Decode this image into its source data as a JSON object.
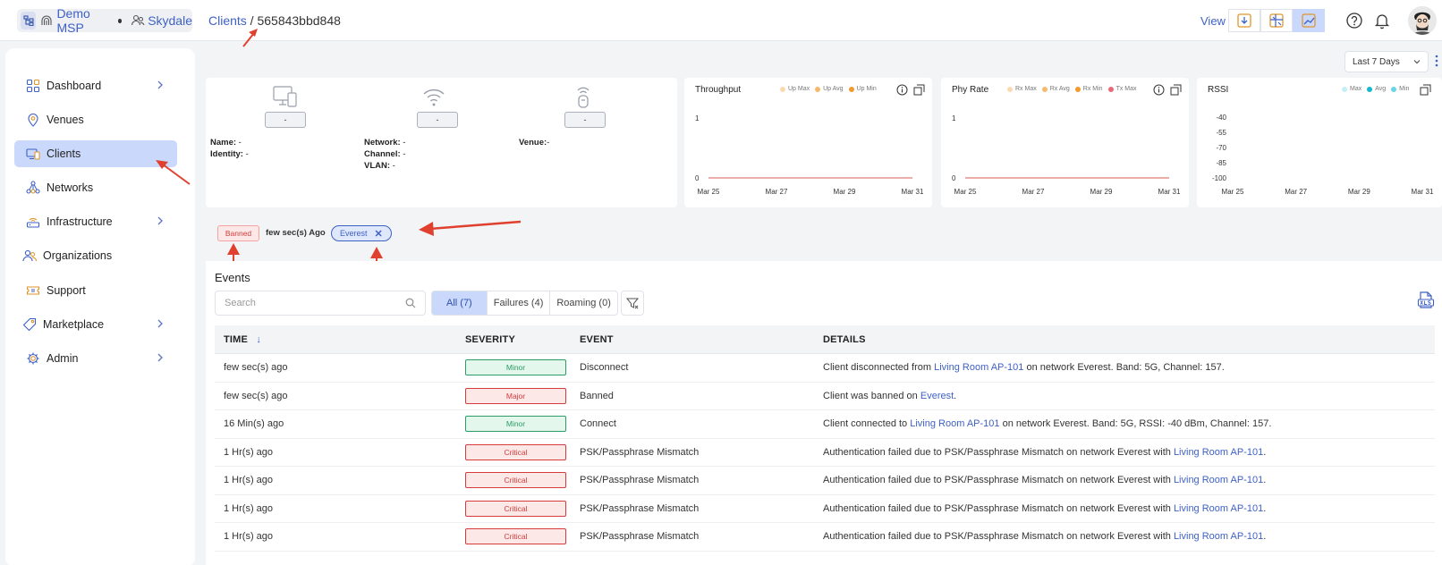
{
  "header": {
    "org_primary": "Demo MSP",
    "org_secondary": "Skydale",
    "breadcrumb_root": "Clients",
    "breadcrumb_sep": " / ",
    "breadcrumb_current": "565843bbd848",
    "view_label": "View",
    "accent_color": "#3f61c4"
  },
  "sidebar": {
    "items": [
      {
        "label": "Dashboard",
        "icon": "dashboard-grid-icon",
        "has_chevron": true,
        "active": false
      },
      {
        "label": "Venues",
        "icon": "location-pin-icon",
        "has_chevron": false,
        "active": false
      },
      {
        "label": "Clients",
        "icon": "devices-icon",
        "has_chevron": false,
        "active": true
      },
      {
        "label": "Networks",
        "icon": "network-nodes-icon",
        "has_chevron": false,
        "active": false
      },
      {
        "label": "Infrastructure",
        "icon": "router-icon",
        "has_chevron": true,
        "active": false
      },
      {
        "label": "Organizations",
        "icon": "users-icon",
        "has_chevron": false,
        "active": false
      },
      {
        "label": "Support",
        "icon": "ticket-icon",
        "has_chevron": false,
        "active": false
      },
      {
        "label": "Marketplace",
        "icon": "tag-icon",
        "has_chevron": true,
        "active": false
      },
      {
        "label": "Admin",
        "icon": "admin-gear-icon",
        "has_chevron": true,
        "active": false
      }
    ]
  },
  "range": {
    "value": "Last 7 Days"
  },
  "client_info": {
    "boxes": [
      "-",
      "-",
      "-"
    ],
    "name_label": "Name:",
    "name_value": " -",
    "identity_label": "Identity:",
    "identity_value": " -",
    "network_label": "Network:",
    "network_value": " -",
    "channel_label": "Channel:",
    "channel_value": " -",
    "vlan_label": "VLAN:",
    "vlan_value": " -",
    "venue_label": "Venue:",
    "venue_value": "-"
  },
  "charts": {
    "throughput": {
      "title": "Throughput",
      "legend": [
        "Up Max",
        "Up Avg",
        "Up Min"
      ],
      "legend_colors": [
        "#fbd9b0",
        "#f7b96a",
        "#f39a2c"
      ]
    },
    "phy_rate": {
      "title": "Phy Rate",
      "legend": [
        "Rx Max",
        "Rx Avg",
        "Rx Min",
        "Tx Max"
      ],
      "legend_colors": [
        "#fbd9b0",
        "#f7b96a",
        "#f39a2c",
        "#e86a78"
      ]
    },
    "rssi": {
      "title": "RSSI",
      "legend": [
        "Max",
        "Avg",
        "Min"
      ],
      "legend_colors": [
        "#c5eef7",
        "#16b7cf",
        "#67d6e6"
      ]
    }
  },
  "chart_data": [
    {
      "type": "line",
      "title": "Throughput",
      "x": [
        "Mar 25",
        "Mar 27",
        "Mar 29",
        "Mar 31"
      ],
      "yticks": [
        1,
        0
      ],
      "ylim": [
        0,
        1
      ],
      "series": [
        {
          "name": "Up Max",
          "values": [
            0,
            0,
            0,
            0
          ]
        },
        {
          "name": "Up Avg",
          "values": [
            0,
            0,
            0,
            0
          ]
        },
        {
          "name": "Up Min",
          "values": [
            0,
            0,
            0,
            0
          ]
        }
      ]
    },
    {
      "type": "line",
      "title": "Phy Rate",
      "x": [
        "Mar 25",
        "Mar 27",
        "Mar 29",
        "Mar 31"
      ],
      "yticks": [
        1,
        0
      ],
      "ylim": [
        0,
        1
      ],
      "series": [
        {
          "name": "Rx Max",
          "values": [
            0,
            0,
            0,
            0
          ]
        },
        {
          "name": "Rx Avg",
          "values": [
            0,
            0,
            0,
            0
          ]
        },
        {
          "name": "Rx Min",
          "values": [
            0,
            0,
            0,
            0
          ]
        },
        {
          "name": "Tx Max",
          "values": [
            0,
            0,
            0,
            0
          ]
        }
      ]
    },
    {
      "type": "line",
      "title": "RSSI",
      "x": [
        "Mar 25",
        "Mar 27",
        "Mar 29",
        "Mar 31"
      ],
      "yticks": [
        -40,
        -55,
        -70,
        -85,
        -100
      ],
      "ylim": [
        -100,
        -40
      ],
      "series": [
        {
          "name": "Max",
          "values": []
        },
        {
          "name": "Avg",
          "values": []
        },
        {
          "name": "Min",
          "values": []
        }
      ]
    }
  ],
  "status": {
    "badge": "Banned",
    "time": "few sec(s) Ago",
    "network_chip": "Everest",
    "chip_close": "✕"
  },
  "events": {
    "title": "Events",
    "search_placeholder": "Search",
    "tabs": [
      "All (7)",
      "Failures (4)",
      "Roaming (0)"
    ],
    "columns": [
      "TIME",
      "SEVERITY",
      "EVENT",
      "DETAILS"
    ],
    "sort_arrow": "↓",
    "rows": [
      {
        "time": "few sec(s) ago",
        "severity": "Minor",
        "sev_class": "minor",
        "event": "Disconnect",
        "d1": "Client disconnected from ",
        "link": "Living Room AP-101",
        "d2": " on network Everest. Band: 5G, Channel: 157."
      },
      {
        "time": "few sec(s) ago",
        "severity": "Major",
        "sev_class": "major",
        "event": "Banned",
        "d1": "Client was banned on ",
        "link": "Everest",
        "d2": "."
      },
      {
        "time": "16 Min(s) ago",
        "severity": "Minor",
        "sev_class": "minor",
        "event": "Connect",
        "d1": "Client connected to ",
        "link": "Living Room AP-101",
        "d2": " on network Everest. Band: 5G, RSSI: -40 dBm, Channel: 157."
      },
      {
        "time": "1 Hr(s) ago",
        "severity": "Critical",
        "sev_class": "critical",
        "event": "PSK/Passphrase Mismatch",
        "d1": "Authentication failed due to PSK/Passphrase Mismatch on network Everest with ",
        "link": "Living Room AP-101",
        "d2": "."
      },
      {
        "time": "1 Hr(s) ago",
        "severity": "Critical",
        "sev_class": "critical",
        "event": "PSK/Passphrase Mismatch",
        "d1": "Authentication failed due to PSK/Passphrase Mismatch on network Everest with ",
        "link": "Living Room AP-101",
        "d2": "."
      },
      {
        "time": "1 Hr(s) ago",
        "severity": "Critical",
        "sev_class": "critical",
        "event": "PSK/Passphrase Mismatch",
        "d1": "Authentication failed due to PSK/Passphrase Mismatch on network Everest with ",
        "link": "Living Room AP-101",
        "d2": "."
      },
      {
        "time": "1 Hr(s) ago",
        "severity": "Critical",
        "sev_class": "critical",
        "event": "PSK/Passphrase Mismatch",
        "d1": "Authentication failed due to PSK/Passphrase Mismatch on network Everest with ",
        "link": "Living Room AP-101",
        "d2": "."
      }
    ]
  }
}
